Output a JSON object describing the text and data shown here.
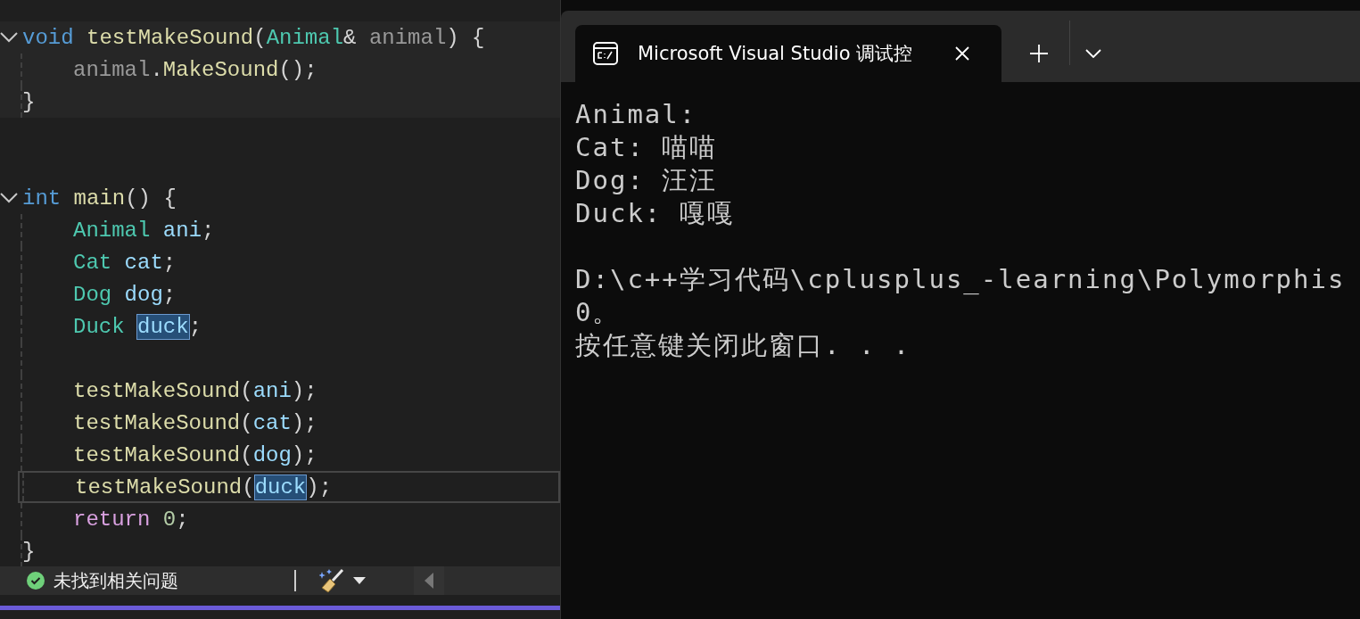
{
  "editor": {
    "lines": [
      {
        "kind": "code",
        "fold": true,
        "indent": false,
        "tokens": [
          {
            "text": "void ",
            "kind": "keyword"
          },
          {
            "text": "testMakeSound",
            "kind": "function"
          },
          {
            "text": "(",
            "kind": "plain"
          },
          {
            "text": "Animal",
            "kind": "type"
          },
          {
            "text": "& ",
            "kind": "plain"
          },
          {
            "text": "animal",
            "kind": "param"
          },
          {
            "text": ") {",
            "kind": "plain"
          }
        ]
      },
      {
        "kind": "code",
        "indent": true,
        "tokens": [
          {
            "text": "animal",
            "kind": "param"
          },
          {
            "text": ".",
            "kind": "plain"
          },
          {
            "text": "MakeSound",
            "kind": "function"
          },
          {
            "text": "();",
            "kind": "plain"
          }
        ]
      },
      {
        "kind": "code",
        "indent": false,
        "tokens": [
          {
            "text": "}",
            "kind": "plain"
          }
        ]
      },
      {
        "kind": "blank"
      },
      {
        "kind": "blank"
      },
      {
        "kind": "code",
        "fold": true,
        "indent": false,
        "tokens": [
          {
            "text": "int ",
            "kind": "keyword"
          },
          {
            "text": "main",
            "kind": "function"
          },
          {
            "text": "() {",
            "kind": "plain"
          }
        ]
      },
      {
        "kind": "code",
        "indent": true,
        "tokens": [
          {
            "text": "Animal ",
            "kind": "type"
          },
          {
            "text": "ani",
            "kind": "local"
          },
          {
            "text": ";",
            "kind": "plain"
          }
        ]
      },
      {
        "kind": "code",
        "indent": true,
        "tokens": [
          {
            "text": "Cat ",
            "kind": "type"
          },
          {
            "text": "cat",
            "kind": "local"
          },
          {
            "text": ";",
            "kind": "plain"
          }
        ]
      },
      {
        "kind": "code",
        "indent": true,
        "tokens": [
          {
            "text": "Dog ",
            "kind": "type"
          },
          {
            "text": "dog",
            "kind": "local"
          },
          {
            "text": ";",
            "kind": "plain"
          }
        ]
      },
      {
        "kind": "code",
        "indent": true,
        "tokens": [
          {
            "text": "Duck ",
            "kind": "type"
          },
          {
            "text": "duck",
            "kind": "match"
          },
          {
            "text": ";",
            "kind": "plain"
          }
        ]
      },
      {
        "kind": "blank"
      },
      {
        "kind": "code",
        "indent": true,
        "tokens": [
          {
            "text": "testMakeSound",
            "kind": "function"
          },
          {
            "text": "(",
            "kind": "plain"
          },
          {
            "text": "ani",
            "kind": "local"
          },
          {
            "text": ");",
            "kind": "plain"
          }
        ]
      },
      {
        "kind": "code",
        "indent": true,
        "tokens": [
          {
            "text": "testMakeSound",
            "kind": "function"
          },
          {
            "text": "(",
            "kind": "plain"
          },
          {
            "text": "cat",
            "kind": "local"
          },
          {
            "text": ");",
            "kind": "plain"
          }
        ]
      },
      {
        "kind": "code",
        "indent": true,
        "tokens": [
          {
            "text": "testMakeSound",
            "kind": "function"
          },
          {
            "text": "(",
            "kind": "plain"
          },
          {
            "text": "dog",
            "kind": "local"
          },
          {
            "text": ");",
            "kind": "plain"
          }
        ]
      },
      {
        "kind": "code",
        "indent": true,
        "current": true,
        "tokens": [
          {
            "text": "testMakeSound",
            "kind": "function"
          },
          {
            "text": "(",
            "kind": "plain"
          },
          {
            "text": "duck",
            "kind": "match"
          },
          {
            "text": ");",
            "kind": "plain"
          }
        ]
      },
      {
        "kind": "code",
        "indent": true,
        "tokens": [
          {
            "text": "return ",
            "kind": "control"
          },
          {
            "text": "0",
            "kind": "number"
          },
          {
            "text": ";",
            "kind": "plain"
          }
        ]
      },
      {
        "kind": "code",
        "indent": false,
        "tokens": [
          {
            "text": "}",
            "kind": "plain"
          }
        ]
      }
    ]
  },
  "status_bar": {
    "message": "未找到相关问题",
    "ok": true
  },
  "terminal": {
    "tab": {
      "title": "Microsoft Visual Studio 调试控",
      "selected": true
    },
    "output": [
      "Animal:",
      "Cat: 喵喵",
      "Dog: 汪汪",
      "Duck: 嘎嘎"
    ],
    "exit_message": [
      "D:\\c++学习代码\\cplusplus_-learning\\Polymorphis",
      "0。",
      "按任意键关闭此窗口. . ."
    ]
  }
}
